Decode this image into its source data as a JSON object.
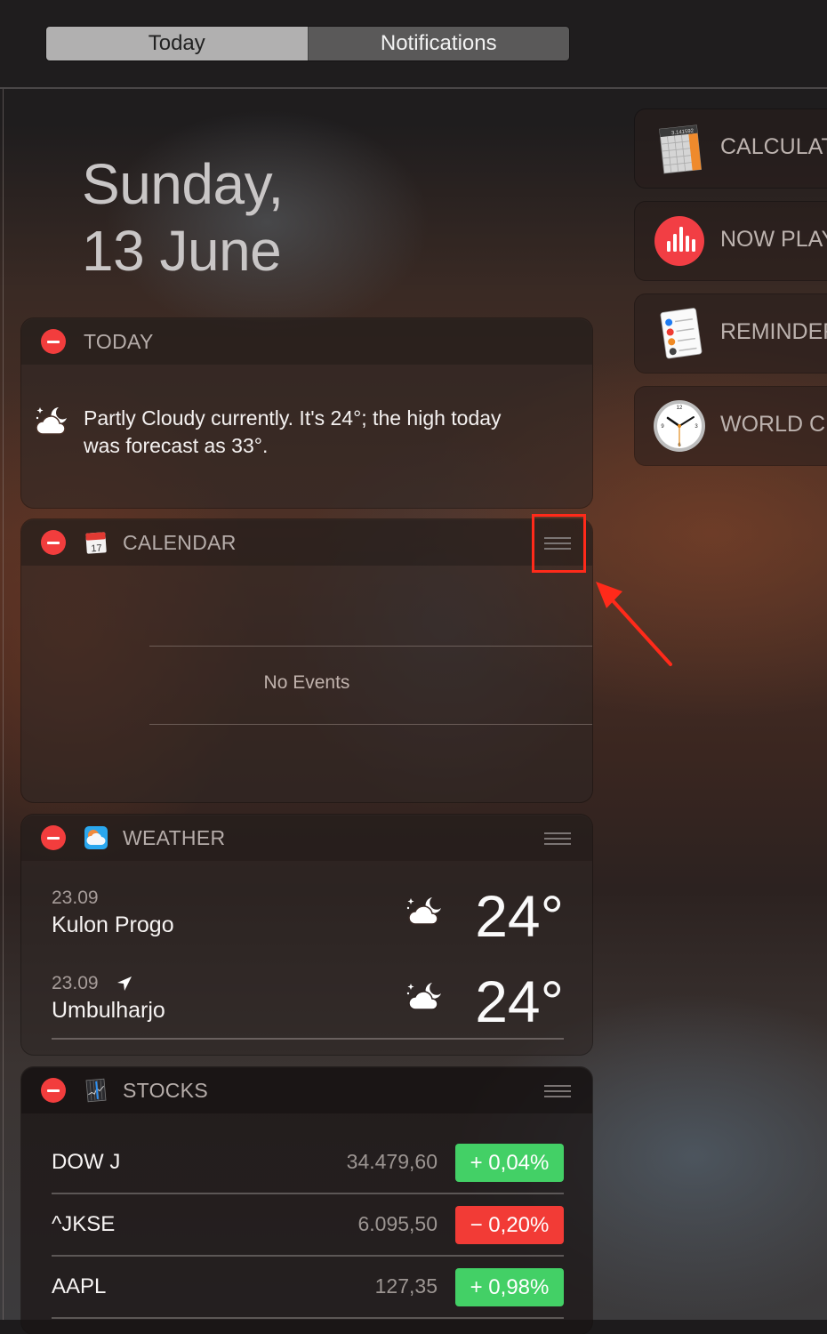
{
  "tabs": [
    {
      "label": "Today",
      "selected": true
    },
    {
      "label": "Notifications",
      "selected": false
    }
  ],
  "date": {
    "line1": "Sunday,",
    "line2": "13 June"
  },
  "widgets": {
    "today": {
      "title": "TODAY",
      "icon": "partly-cloudy-night-icon",
      "text": "Partly Cloudy currently. It's 24°; the high today was forecast as 33°."
    },
    "calendar": {
      "title": "CALENDAR",
      "icon": "calendar-app-icon",
      "icon_day": "17",
      "empty_text": "No Events"
    },
    "weather": {
      "title": "WEATHER",
      "icon": "weather-app-icon",
      "rows": [
        {
          "time": "23.09",
          "location": "Kulon Progo",
          "temp": "24°",
          "current_location": false,
          "condition": "partly-cloudy-night-icon"
        },
        {
          "time": "23.09",
          "location": "Umbulharjo",
          "temp": "24°",
          "current_location": true,
          "condition": "partly-cloudy-night-icon"
        }
      ]
    },
    "stocks": {
      "title": "STOCKS",
      "icon": "stocks-app-icon",
      "rows": [
        {
          "symbol": "DOW J",
          "price": "34.479,60",
          "change": "+ 0,04%",
          "direction": "up"
        },
        {
          "symbol": "^JKSE",
          "price": "6.095,50",
          "change": "− 0,20%",
          "direction": "down"
        },
        {
          "symbol": "AAPL",
          "price": "127,35",
          "change": "+ 0,98%",
          "direction": "up"
        }
      ]
    }
  },
  "available_widgets": [
    {
      "label": "CALCULATOR",
      "icon": "calculator-icon",
      "display": "3.141592"
    },
    {
      "label": "NOW PLAYING",
      "icon": "now-playing-icon"
    },
    {
      "label": "REMINDERS",
      "icon": "reminders-icon"
    },
    {
      "label": "WORLD CLOCK",
      "icon": "world-clock-icon"
    }
  ],
  "colors": {
    "remove": "#f23d3d",
    "stock_up": "#43d066",
    "stock_down": "#f23b36",
    "annotation": "#ff2a1a"
  }
}
